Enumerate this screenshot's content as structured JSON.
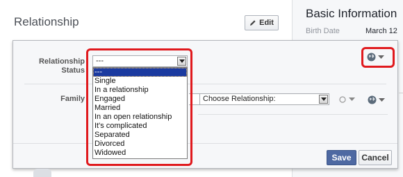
{
  "background": {
    "section_title": "Relationship",
    "edit_label": "Edit",
    "basic_info_title": "Basic Information",
    "birth_date_label": "Birth Date",
    "birth_date_value": "March 12"
  },
  "panel": {
    "relationship_status_label": "Relationship Status",
    "status_selected": "---",
    "status_options": [
      "---",
      "Single",
      "In a relationship",
      "Engaged",
      "Married",
      "In an open relationship",
      "It's complicated",
      "Separated",
      "Divorced",
      "Widowed"
    ],
    "family_label": "Family",
    "family_select_value": "Choose Relationship:",
    "save_label": "Save",
    "cancel_label": "Cancel"
  },
  "icons": {
    "privacy": "globe-icon",
    "audience": "circle-icon",
    "edit": "pencil-icon"
  },
  "colors": {
    "highlight": "#e0191d",
    "save_button": "#4e69a2",
    "selected_option": "#1b3aa0"
  }
}
